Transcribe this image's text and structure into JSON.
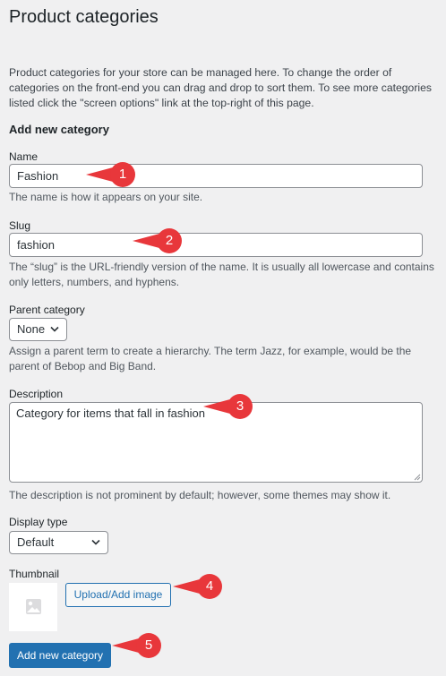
{
  "page": {
    "title": "Product categories",
    "intro": "Product categories for your store can be managed here. To change the order of categories on the front-end you can drag and drop to sort them. To see more categories listed click the \"screen options\" link at the top-right of this page."
  },
  "form": {
    "heading": "Add new category",
    "name": {
      "label": "Name",
      "value": "Fashion",
      "help": "The name is how it appears on your site."
    },
    "slug": {
      "label": "Slug",
      "value": "fashion",
      "help": "The “slug” is the URL-friendly version of the name. It is usually all lowercase and contains only letters, numbers, and hyphens."
    },
    "parent": {
      "label": "Parent category",
      "selected": "None",
      "help": "Assign a parent term to create a hierarchy. The term Jazz, for example, would be the parent of Bebop and Big Band."
    },
    "description": {
      "label": "Description",
      "value": "Category for items that fall in fashion",
      "help": "The description is not prominent by default; however, some themes may show it."
    },
    "display_type": {
      "label": "Display type",
      "selected": "Default"
    },
    "thumbnail": {
      "label": "Thumbnail",
      "upload_label": "Upload/Add image",
      "placeholder_icon": "image-placeholder-icon"
    },
    "submit_label": "Add new category"
  },
  "callouts": [
    "1",
    "2",
    "3",
    "4",
    "5"
  ],
  "colors": {
    "background": "#f0f0f1",
    "primary": "#2271b1",
    "callout": "#e8373b"
  }
}
